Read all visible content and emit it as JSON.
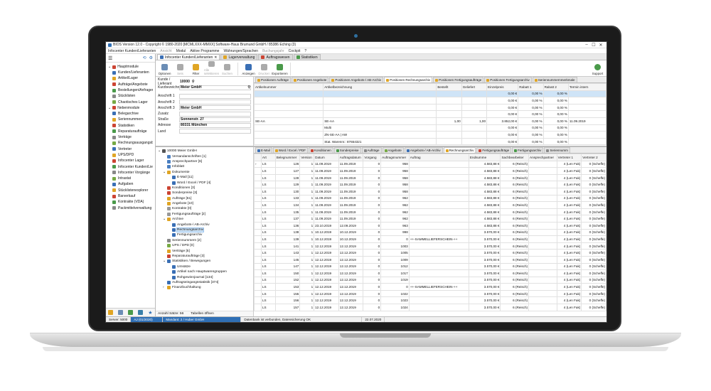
{
  "window": {
    "title": "BIOS Version 12.0 - Copyright © 1980-2020 [MCMLXXX-MMXX] Software-Haus Brumund GmbH / 85386 Eching (3)",
    "controls": [
      "–",
      "☐",
      "✕"
    ]
  },
  "menu": {
    "items": [
      {
        "label": "Infocenter Kunden/Lieferanten",
        "dim": false
      },
      {
        "label": "Ansicht",
        "dim": true
      },
      {
        "label": "Modul",
        "dim": false
      },
      {
        "label": "Aktive Programme",
        "dim": false
      },
      {
        "label": "Währungen/Sprachen",
        "dim": false
      },
      {
        "label": "Buchungsjahr",
        "dim": true
      },
      {
        "label": "Cockpit",
        "dim": false
      },
      {
        "label": "?",
        "dim": false
      }
    ]
  },
  "sidebar": {
    "group1": "Hauptmodule",
    "items1": [
      "Kunden/Lieferanten",
      "Artikel/Lager",
      "Aufträge/Angebote",
      "Bestellungen/Anfragen",
      "Stücklisten",
      "Chaotisches Lager"
    ],
    "group2": "Nebenmodule",
    "items2": [
      "Belegarchive",
      "Seriennummern",
      "Statistiken",
      "Reparaturaufträge",
      "Verträge",
      "Rechnungsausgangsbuch",
      "Vertreter",
      "UPS/DPD",
      "Infocenter Lager",
      "Infocenter Kunden/Liefer...",
      "Infocenter Vorgänge",
      "Intrastat",
      "Aufgaben",
      "Stücklistenexplorer",
      "Barverkauf",
      "Kontrakte (VDA)",
      "Packmittelverwaltung"
    ]
  },
  "doctabs": [
    "Infocenter Kunden/Lieferanten",
    "Lagerverwaltung",
    "Auftragswesen",
    "Statistiken"
  ],
  "ribbon": {
    "buttons": [
      {
        "label": "Optionen",
        "dim": false
      },
      {
        "label": "Sets",
        "dim": true
      },
      {
        "label": "Filter",
        "dim": false
      },
      {
        "label": "Alle selektieren",
        "dim": true
      },
      {
        "label": "Suchen",
        "dim": true
      },
      {
        "label": "Anzeigen",
        "dim": false
      },
      {
        "label": "Drucken",
        "dim": true
      },
      {
        "label": "Exportieren",
        "dim": false
      }
    ],
    "support": "Support"
  },
  "form": {
    "kunde_label": "Kunde / Lieferant",
    "kunde_value": "10000",
    "kurz_label": "Kurzbezeichnung",
    "kurz_value": "Meier GmbH",
    "anschrift1": "Anschrift 1",
    "anschrift2": "Anschrift 2",
    "anschrift3": "Anschrift 3",
    "anschrift3_value": "Meier GmbH",
    "zusatz": "Zusatz",
    "strasse_label": "Straße",
    "strasse_value": "Sonnenstr. 27",
    "adresse_label": "Adresse",
    "adresse_value": "80331 München",
    "land_label": "Land"
  },
  "postabs": [
    "Positionen Aufträge",
    "Positionen Angebote",
    "Positionen Angebots-/ AB-Archiv",
    "Positionen Rechnungsarchiv",
    "Positionen Fertigungsaufträge",
    "Positionen Fertigungsarchiv",
    "Seriennummernmerkmale"
  ],
  "positions": {
    "columns": [
      "Artikelnummer",
      "Artikelbezeichnung",
      "Bestellt",
      "Geliefert",
      "Einzelpreis",
      "Rabatt 1",
      "Rabatt 2",
      "Termin intern"
    ],
    "rows": [
      [
        "",
        "",
        "",
        "",
        "0,00 €",
        "0,00 %",
        "0,00 %",
        ""
      ],
      [
        "",
        "",
        "",
        "",
        "0,00 €",
        "0,00 %",
        "0,00 %",
        ""
      ],
      [
        "",
        "",
        "",
        "",
        "0,00 €",
        "0,00 %",
        "0,00 %",
        ""
      ],
      [
        "",
        "",
        "",
        "",
        "0,00 €",
        "0,00 %",
        "0,00 %",
        ""
      ],
      [
        "SE-AA",
        "SE-AA",
        "1,00",
        "1,00",
        "3.852,00 €",
        "0,00 %",
        "0,00 %",
        "11.09.2019"
      ],
      [
        "",
        "Multi",
        "",
        "",
        "0,00 €",
        "0,00 %",
        "0,00 %",
        ""
      ],
      [
        "",
        "ZN-SE-AA | AW",
        "",
        "",
        "0,00 €",
        "0,00 %",
        "0,00 %",
        ""
      ],
      [
        "",
        "Stat. Warennr.: 87654321",
        "",
        "",
        "0,00 €",
        "0,00 %",
        "0,00 %",
        ""
      ]
    ]
  },
  "tree": {
    "nodes": [
      {
        "label": "10000 Meier GmbH",
        "level": 0,
        "toggle": "⌄",
        "color": "#555"
      },
      {
        "label": "Versandanschriften [1]",
        "level": 1,
        "toggle": "",
        "color": "#4a7fc1"
      },
      {
        "label": "Ansprechpartner [6]",
        "level": 1,
        "toggle": "",
        "color": "#4a7fc1"
      },
      {
        "label": "Infoblatt",
        "level": 1,
        "toggle": "",
        "color": "#4a7fc1"
      },
      {
        "label": "Dokumente",
        "level": 1,
        "toggle": "⌄",
        "color": "#e0a524"
      },
      {
        "label": "E-Mail [11]",
        "level": 2,
        "toggle": "",
        "color": "#3a6fb5"
      },
      {
        "label": "Word / Excel / PDF [4]",
        "level": 2,
        "toggle": "",
        "color": "#3a6fb5"
      },
      {
        "label": "Konditionen [3]",
        "level": 1,
        "toggle": "",
        "color": "#c43"
      },
      {
        "label": "Sonderpreise [3]",
        "level": 1,
        "toggle": "",
        "color": "#c43"
      },
      {
        "label": "Aufträge [61]",
        "level": 1,
        "toggle": "",
        "color": "#e0a524"
      },
      {
        "label": "Angebote [10]",
        "level": 1,
        "toggle": "",
        "color": "#e0a524"
      },
      {
        "label": "Kontrakte [0]",
        "level": 1,
        "toggle": "",
        "color": "#999"
      },
      {
        "label": "Fertigungsaufträge [2]",
        "level": 1,
        "toggle": "",
        "color": "#999"
      },
      {
        "label": "Archive",
        "level": 1,
        "toggle": "⌄",
        "color": "#e0a524"
      },
      {
        "label": "Angebots-/ AB-Archiv",
        "level": 2,
        "toggle": "",
        "color": "#3a6fb5"
      },
      {
        "label": "Rechnungsarchiv",
        "level": 2,
        "toggle": "",
        "color": "#3a6fb5",
        "selected": true
      },
      {
        "label": "Fertigungsarchiv",
        "level": 2,
        "toggle": "",
        "color": "#3a6fb5"
      },
      {
        "label": "Seriennummern [2]",
        "level": 1,
        "toggle": "",
        "color": "#888"
      },
      {
        "label": "UPS / DPD [0]",
        "level": 1,
        "toggle": "",
        "color": "#7a4"
      },
      {
        "label": "Verträge [5]",
        "level": 1,
        "toggle": "",
        "color": "#e0a524"
      },
      {
        "label": "Reparaturaufträge [3]",
        "level": 1,
        "toggle": "",
        "color": "#c43"
      },
      {
        "label": "Statistiken / Bewegungen",
        "level": 1,
        "toggle": "⌄",
        "color": "#3a6fb5"
      },
      {
        "label": "Umsätze",
        "level": 2,
        "toggle": "",
        "color": "#3a6fb5"
      },
      {
        "label": "Artikel nach Hauptwarengruppen",
        "level": 2,
        "toggle": "",
        "color": "#3a6fb5"
      },
      {
        "label": "Rohgewinnjournal [134]",
        "level": 2,
        "toggle": "",
        "color": "#3a6fb5"
      },
      {
        "label": "Auftragseingangsstatistik [374]",
        "level": 1,
        "toggle": "",
        "color": "#3a6fb5"
      },
      {
        "label": "Finanzbuchhaltung",
        "level": 1,
        "toggle": "›",
        "color": "#e0a524"
      }
    ],
    "footer_count": "Anzahl Sätze: 56",
    "footer_open": "Tabellen öffnen"
  },
  "doctabs2": [
    "E-Mail",
    "Word / Excel / PDF",
    "Konditionen",
    "Sonderpreise",
    "Aufträge",
    "Angebote",
    "Angebots-/ AB-Archiv",
    "Rechnungsarchiv",
    "Fertigungsaufträge",
    "Fertigungsarchiv",
    "Seriennumm"
  ],
  "docs": {
    "columns": [
      "",
      "Art",
      "Belegnummer",
      "Version",
      "Datum",
      "Auftragsdatum",
      "Vorgang",
      "Auftragsnummer",
      "Auftrag",
      "Endsumme",
      "Sachbearbeiter",
      "Ansprechpartner",
      "Vertreter 1",
      "Vertreter 2"
    ],
    "rows": [
      [
        "›",
        "LS",
        "126",
        "1",
        "11.09.2019",
        "11.09.2019",
        "0",
        "958",
        "",
        "4.583,88 €",
        "6 (Reisch)",
        "",
        "4 (Len Fak)",
        "0 (Scheffe)"
      ],
      [
        "",
        "LS",
        "127",
        "1",
        "11.09.2019",
        "11.09.2019",
        "0",
        "958",
        "",
        "4.583,88 €",
        "6 (Reisch)",
        "",
        "4 (Len Fak)",
        "0 (Scheffe)"
      ],
      [
        "",
        "LS",
        "128",
        "1",
        "11.09.2019",
        "11.09.2019",
        "0",
        "958",
        "",
        "4.583,88 €",
        "6 (Reisch)",
        "",
        "4 (Len Fak)",
        "0 (Scheffe)"
      ],
      [
        "",
        "LS",
        "129",
        "1",
        "11.09.2019",
        "11.09.2019",
        "0",
        "958",
        "",
        "4.583,88 €",
        "6 (Reisch)",
        "",
        "4 (Len Fak)",
        "0 (Scheffe)"
      ],
      [
        "",
        "LS",
        "130",
        "1",
        "11.09.2019",
        "11.09.2019",
        "0",
        "958",
        "",
        "4.583,88 €",
        "6 (Reisch)",
        "",
        "4 (Len Fak)",
        "0 (Scheffe)"
      ],
      [
        "",
        "LS",
        "133",
        "1",
        "11.09.2019",
        "11.09.2019",
        "0",
        "962",
        "",
        "4.583,88 €",
        "6 (Reisch)",
        "",
        "4 (Len Fak)",
        "0 (Scheffe)"
      ],
      [
        "",
        "LS",
        "134",
        "1",
        "11.09.2019",
        "11.09.2019",
        "0",
        "962",
        "",
        "4.583,88 €",
        "6 (Reisch)",
        "",
        "4 (Len Fak)",
        "0 (Scheffe)"
      ],
      [
        "",
        "LS",
        "135",
        "1",
        "11.09.2019",
        "11.09.2019",
        "0",
        "962",
        "",
        "4.583,88 €",
        "6 (Reisch)",
        "",
        "4 (Len Fak)",
        "0 (Scheffe)"
      ],
      [
        "",
        "LS",
        "137",
        "1",
        "11.09.2019",
        "11.09.2019",
        "0",
        "962",
        "",
        "4.583,88 €",
        "6 (Reisch)",
        "",
        "4 (Len Fak)",
        "0 (Scheffe)"
      ],
      [
        "",
        "LS",
        "136",
        "1",
        "23.10.2019",
        "12.09.2019",
        "0",
        "963",
        "",
        "4.583,88 €",
        "6 (Reisch)",
        "",
        "4 (Len Fak)",
        "0 (Scheffe)"
      ],
      [
        "",
        "LS",
        "138",
        "1",
        "10.12.2019",
        "10.12.2019",
        "0",
        "998",
        "",
        "3.570,00 €",
        "6 (Reisch)",
        "",
        "4 (Len Fak)",
        "0 (Scheffe)"
      ],
      [
        "",
        "LS",
        "139",
        "1",
        "10.12.2019",
        "10.12.2019",
        "0",
        "0",
        "++-SAMMELLIEFERSCHEIN-++",
        "3.570,00 €",
        "6 (Reisch)",
        "",
        "4 (Len Fak)",
        "0 (Scheffe)"
      ],
      [
        "",
        "LS",
        "141",
        "1",
        "12.12.2019",
        "12.12.2019",
        "0",
        "1003",
        "",
        "3.570,00 €",
        "6 (Reisch)",
        "",
        "4 (Len Fak)",
        "0 (Scheffe)"
      ],
      [
        "",
        "LS",
        "143",
        "1",
        "12.12.2019",
        "12.12.2019",
        "0",
        "1005",
        "",
        "3.570,00 €",
        "6 (Reisch)",
        "",
        "4 (Len Fak)",
        "0 (Scheffe)"
      ],
      [
        "",
        "LS",
        "145",
        "1",
        "12.12.2019",
        "12.12.2019",
        "0",
        "1009",
        "",
        "3.570,00 €",
        "6 (Reisch)",
        "",
        "4 (Len Fak)",
        "0 (Scheffe)"
      ],
      [
        "",
        "LS",
        "147",
        "1",
        "12.12.2019",
        "12.12.2019",
        "0",
        "1012",
        "",
        "3.570,00 €",
        "6 (Reisch)",
        "",
        "4 (Len Fak)",
        "0 (Scheffe)"
      ],
      [
        "",
        "LS",
        "150",
        "1",
        "12.12.2019",
        "12.12.2019",
        "0",
        "1017",
        "",
        "3.570,00 €",
        "6 (Reisch)",
        "",
        "4 (Len Fak)",
        "0 (Scheffe)"
      ],
      [
        "",
        "LS",
        "152",
        "1",
        "12.12.2019",
        "12.12.2019",
        "0",
        "1019",
        "",
        "3.570,00 €",
        "6 (Reisch)",
        "",
        "4 (Len Fak)",
        "0 (Scheffe)"
      ],
      [
        "",
        "LS",
        "153",
        "1",
        "12.12.2019",
        "12.12.2019",
        "0",
        "0",
        "++-SAMMELLIEFERSCHEIN-++",
        "3.570,00 €",
        "6 (Reisch)",
        "",
        "4 (Len Fak)",
        "0 (Scheffe)"
      ],
      [
        "",
        "LS",
        "155",
        "1",
        "12.12.2019",
        "12.12.2019",
        "0",
        "1022",
        "",
        "3.570,00 €",
        "6 (Reisch)",
        "",
        "4 (Len Fak)",
        "0 (Scheffe)"
      ],
      [
        "",
        "LS",
        "156",
        "1",
        "12.12.2019",
        "12.12.2019",
        "0",
        "1023",
        "",
        "3.570,00 €",
        "6 (Reisch)",
        "",
        "4 (Len Fak)",
        "0 (Scheffe)"
      ],
      [
        "",
        "LS",
        "157",
        "1",
        "12.12.2019",
        "12.12.2019",
        "0",
        "1024",
        "",
        "3.570,00 €",
        "6 (Reisch)",
        "",
        "4 (Len Fak)",
        "0 (Scheffe)"
      ]
    ]
  },
  "status": {
    "seg1": "Server: 5000",
    "seg2": "AJ (01/2020)",
    "seg3": "Mandant: 2 / Huber GmbH",
    "seg4": "Datenbank ist verbunden, Datensicherung OK",
    "seg5": "22.07.2020"
  }
}
